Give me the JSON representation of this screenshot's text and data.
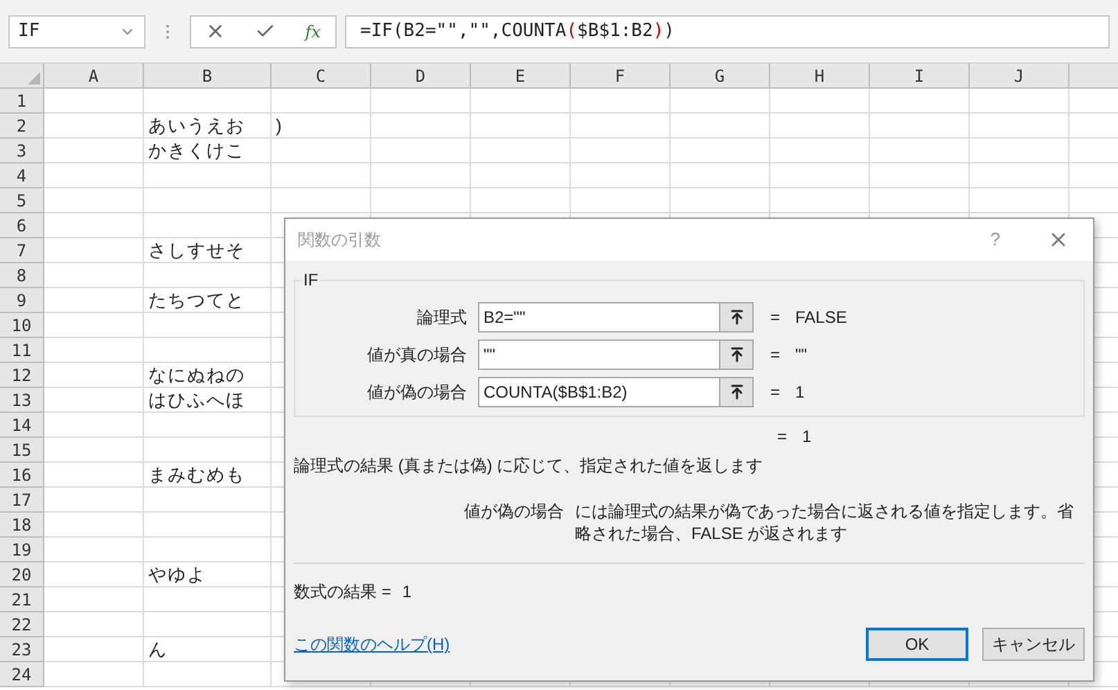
{
  "formula_bar": {
    "name_box": "IF",
    "function_button": "fx",
    "formula": [
      {
        "kind": "plain",
        "text": "=IF(B2=\"\",\"\",COUNTA"
      },
      {
        "kind": "paren",
        "text": "("
      },
      {
        "kind": "plain",
        "text": "$B$1:B2"
      },
      {
        "kind": "paren",
        "text": ")"
      },
      {
        "kind": "plain",
        "text": ")"
      }
    ]
  },
  "sheet": {
    "columns": [
      "A",
      "B",
      "C",
      "D",
      "E",
      "F",
      "G",
      "H",
      "I",
      "J"
    ],
    "rows": [
      {
        "number": "1",
        "cells": []
      },
      {
        "number": "2",
        "cells": [
          "",
          "あいうえお",
          ")"
        ]
      },
      {
        "number": "3",
        "cells": [
          "",
          "かきくけこ"
        ]
      },
      {
        "number": "4",
        "cells": []
      },
      {
        "number": "5",
        "cells": []
      },
      {
        "number": "6",
        "cells": []
      },
      {
        "number": "7",
        "cells": [
          "",
          "さしすせそ"
        ]
      },
      {
        "number": "8",
        "cells": []
      },
      {
        "number": "9",
        "cells": [
          "",
          "たちつてと"
        ]
      },
      {
        "number": "10",
        "cells": []
      },
      {
        "number": "11",
        "cells": []
      },
      {
        "number": "12",
        "cells": [
          "",
          "なにぬねの"
        ]
      },
      {
        "number": "13",
        "cells": [
          "",
          "はひふへほ"
        ]
      },
      {
        "number": "14",
        "cells": []
      },
      {
        "number": "15",
        "cells": []
      },
      {
        "number": "16",
        "cells": [
          "",
          "まみむめも"
        ]
      },
      {
        "number": "17",
        "cells": []
      },
      {
        "number": "18",
        "cells": []
      },
      {
        "number": "19",
        "cells": []
      },
      {
        "number": "20",
        "cells": [
          "",
          "やゆよ"
        ]
      },
      {
        "number": "21",
        "cells": []
      },
      {
        "number": "22",
        "cells": []
      },
      {
        "number": "23",
        "cells": [
          "",
          "ん"
        ]
      },
      {
        "number": "24",
        "cells": []
      }
    ]
  },
  "dialog": {
    "title": "関数の引数",
    "help_button": "?",
    "group_label": "IF",
    "arguments": [
      {
        "label": "論理式",
        "value": "B2=\"\"",
        "equals": "=",
        "result": "FALSE"
      },
      {
        "label": "値が真の場合",
        "value": "\"\"",
        "equals": "=",
        "result": "\"\""
      },
      {
        "label": "値が偽の場合",
        "value": "COUNTA($B$1:B2)",
        "equals": "=",
        "result": "1"
      }
    ],
    "overall": {
      "equals": "=",
      "result": "1"
    },
    "description": "論理式の結果 (真または偽) に応じて、指定された値を返します",
    "argument_help": {
      "label": "値が偽の場合",
      "text": "には論理式の結果が偽であった場合に返される値を指定します。省略された場合、FALSE が返されます"
    },
    "formula_result": {
      "label": "数式の結果 =",
      "value": "1"
    },
    "help_link": "この関数のヘルプ(H)",
    "buttons": [
      {
        "label": "OK",
        "default": true
      },
      {
        "label": "キャンセル",
        "default": false
      }
    ]
  }
}
